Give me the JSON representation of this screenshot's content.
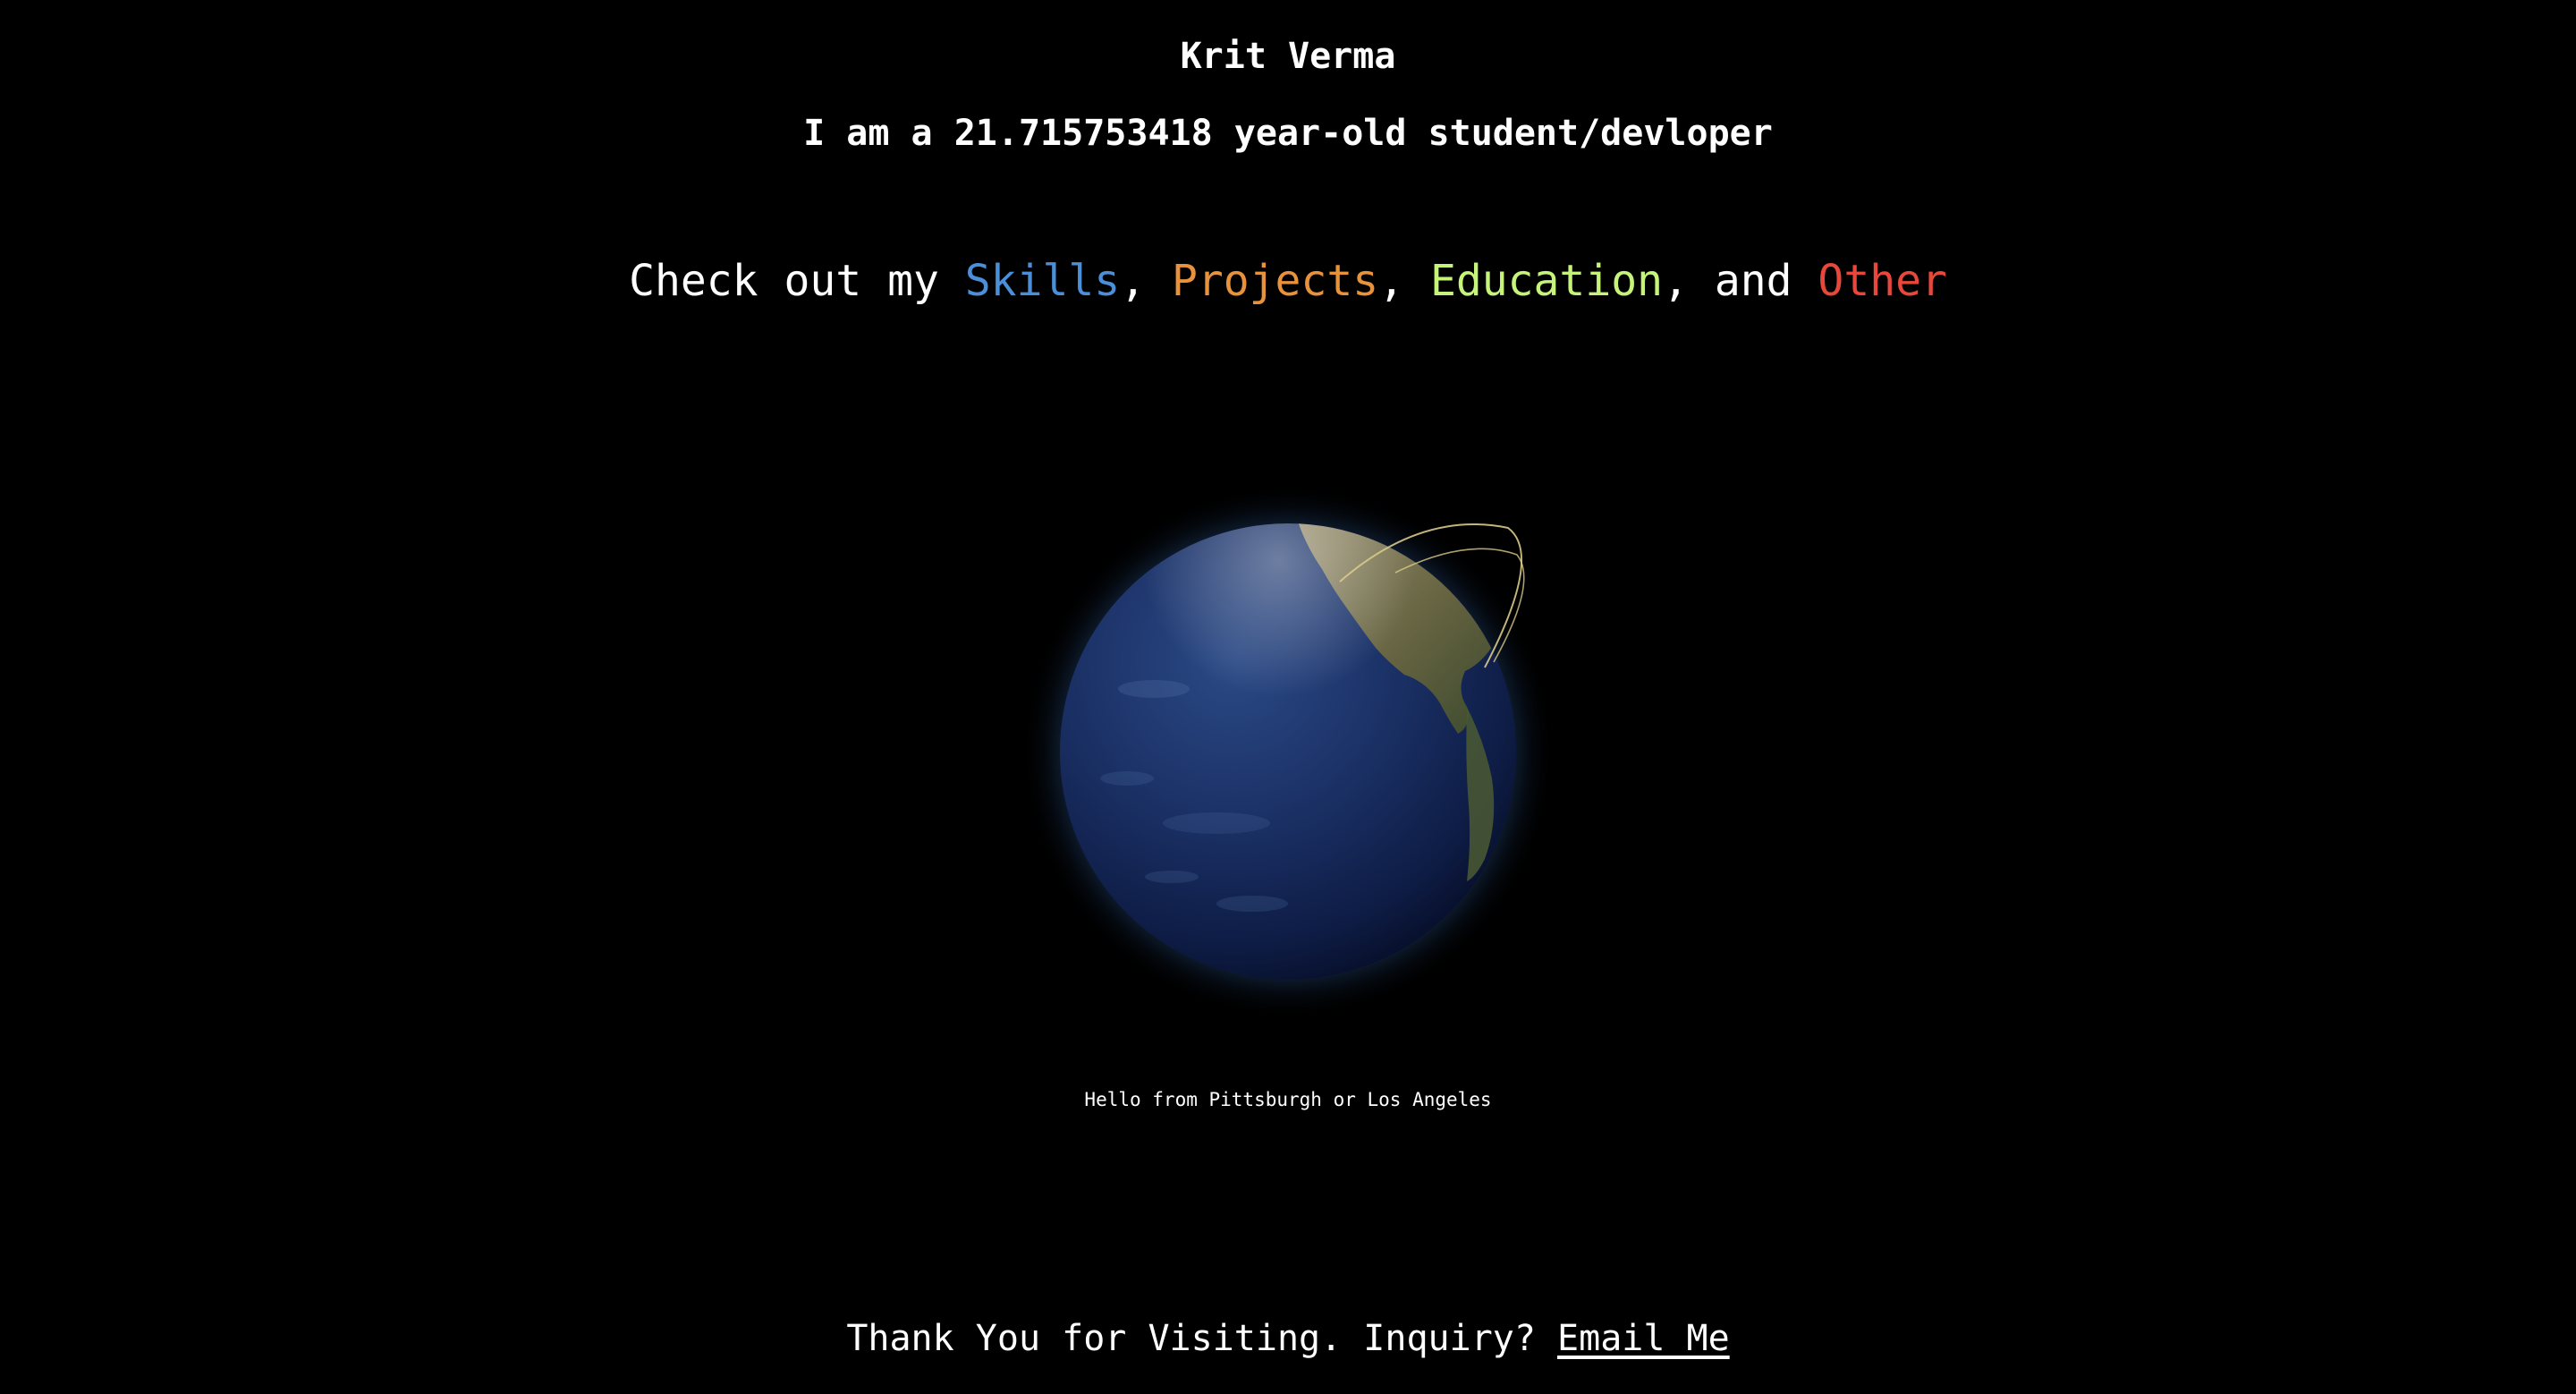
{
  "header": {
    "name": "Krit Verma",
    "age_prefix": "I am a ",
    "age_value": "21.715753418",
    "age_suffix": " year-old student/devloper"
  },
  "nav": {
    "prefix": "Check out my ",
    "sep1": ", ",
    "sep2": ", ",
    "sep3": ", and ",
    "links": [
      {
        "label": "Skills",
        "color": "#4a8fd8"
      },
      {
        "label": "Projects",
        "color": "#e8923c"
      },
      {
        "label": "Education",
        "color": "#c6f37a"
      },
      {
        "label": "Other",
        "color": "#e8483c"
      }
    ]
  },
  "globe": {
    "icon": "earth-globe",
    "caption": "Hello from Pittsburgh or Los Angeles"
  },
  "footer": {
    "text": "Thank You for Visiting. Inquiry? ",
    "link_label": "Email Me"
  }
}
